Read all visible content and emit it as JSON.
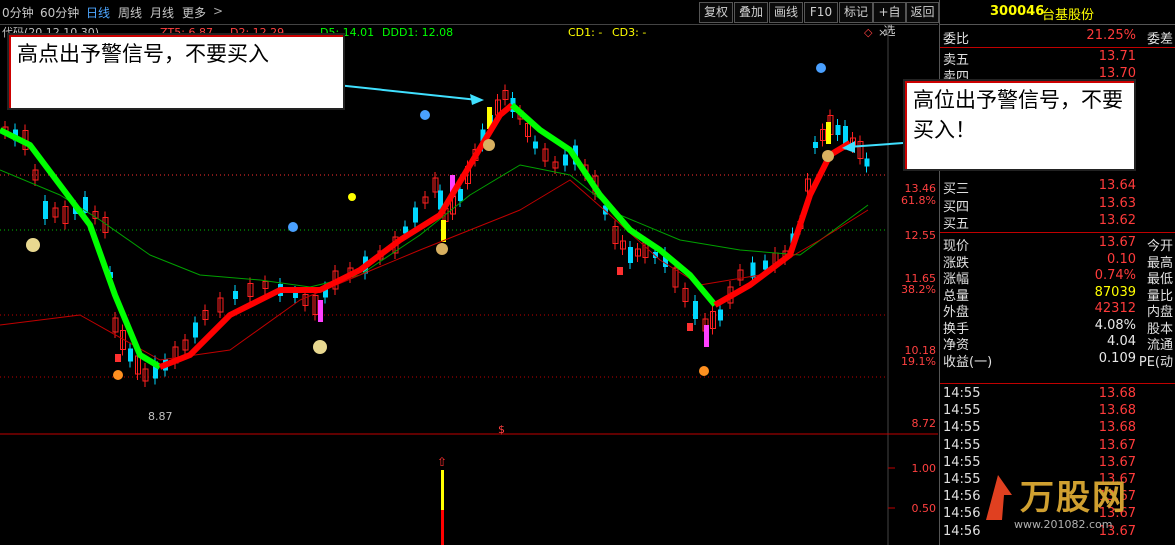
{
  "toolbar": {
    "periods": [
      "0分钟",
      "60分钟",
      "日线",
      "周线",
      "月线",
      "更多"
    ],
    "active_period": "日线",
    "buttons": [
      "复权",
      "叠加",
      "画线",
      "F10",
      "标记",
      "+自选",
      "返回"
    ]
  },
  "chart_header": {
    "title": "代码(20.12.10.30)",
    "zt": "ZT5: 6.87",
    "d2": "D2: 12.29",
    "d5": "D5: 14.01",
    "ddd1": "DDD1: 12.08",
    "cd1": "CD1: -",
    "cd3": "CD3: -"
  },
  "callouts": {
    "left": "高点出予警信号，不要买入",
    "right": "高位出予警信号，不要买入！"
  },
  "price_axis": {
    "ticks": [
      "13.46",
      "61.8%",
      "12.55",
      "11.65",
      "38.2%",
      "10.18",
      "19.1%",
      "8.72"
    ],
    "low_marker": "8.87",
    "sub_ticks": [
      "1.00",
      "0.50"
    ],
    "sub_marker": "$"
  },
  "colors": {
    "up": "#ff2020",
    "down": "#00e0ff",
    "ma_up": "#ff0000",
    "ma_down": "#00ff00",
    "accent": "#ffff00"
  },
  "stock": {
    "code": "300046",
    "name": "台基股份"
  },
  "order_book": {
    "weibi": {
      "label": "委比",
      "value": "21.25%",
      "right": "委差"
    },
    "asks": [
      {
        "label": "卖五",
        "value": "13.71"
      },
      {
        "label": "卖四",
        "value": "13.70"
      }
    ],
    "bids": [
      {
        "label": "买三",
        "value": "13.64"
      },
      {
        "label": "买四",
        "value": "13.63"
      },
      {
        "label": "买五",
        "value": "13.62"
      }
    ]
  },
  "quote": [
    {
      "label": "现价",
      "value": "13.67",
      "right": "今开",
      "color": "red"
    },
    {
      "label": "涨跌",
      "value": "0.10",
      "right": "最高",
      "color": "red"
    },
    {
      "label": "涨幅",
      "value": "0.74%",
      "right": "最低",
      "color": "red"
    },
    {
      "label": "总量",
      "value": "87039",
      "right": "量比",
      "color": "yel"
    },
    {
      "label": "外盘",
      "value": "42312",
      "right": "内盘",
      "color": "red"
    },
    {
      "label": "换手",
      "value": "4.08%",
      "right": "股本",
      "color": "wht"
    },
    {
      "label": "净资",
      "value": "4.04",
      "right": "流通",
      "color": "wht"
    },
    {
      "label": "收益(一)",
      "value": "0.109",
      "right": "PE(动",
      "color": "wht"
    }
  ],
  "ticks_list": [
    {
      "time": "14:55",
      "price": "13.68"
    },
    {
      "time": "14:55",
      "price": "13.68"
    },
    {
      "time": "14:55",
      "price": "13.68"
    },
    {
      "time": "14:55",
      "price": "13.67"
    },
    {
      "time": "14:55",
      "price": "13.67"
    },
    {
      "time": "14:55",
      "price": "13.67"
    },
    {
      "time": "14:56",
      "price": "13.67"
    },
    {
      "time": "14:56",
      "price": "13.67"
    },
    {
      "time": "14:56",
      "price": "13.67"
    }
  ],
  "watermark": {
    "brand": "万股网",
    "url": "www.201082.com"
  }
}
